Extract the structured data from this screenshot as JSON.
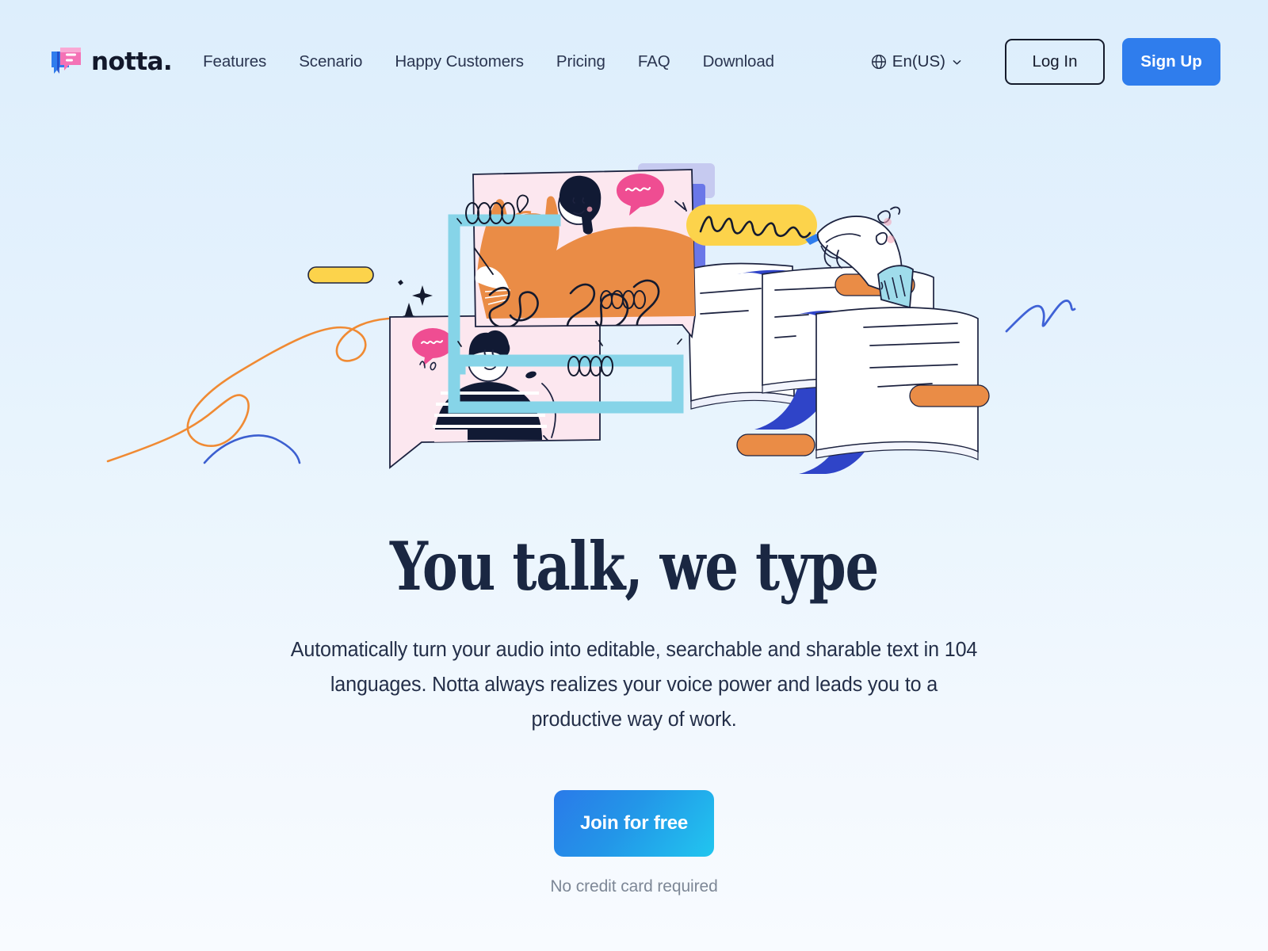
{
  "brand": {
    "name": "notta.",
    "logo_icon": "notta-speech-bubble-logo"
  },
  "nav": {
    "items": [
      {
        "label": "Features"
      },
      {
        "label": "Scenario"
      },
      {
        "label": "Happy Customers"
      },
      {
        "label": "Pricing"
      },
      {
        "label": "FAQ"
      },
      {
        "label": "Download"
      }
    ]
  },
  "header_right": {
    "language": {
      "icon": "globe-icon",
      "value": "En(US)",
      "chevron": "chevron-down-icon"
    },
    "login_label": "Log In",
    "signup_label": "Sign Up"
  },
  "hero": {
    "title": "You talk, we type",
    "subtitle": "Automatically turn your audio into editable, searchable and sharable text in 104 languages. Notta always realizes your voice power and leads you to a productive way of work.",
    "cta_label": "Join for free",
    "cta_note": "No credit card required",
    "illustration": {
      "name": "voice-to-text-hero-illustration",
      "elements": [
        "pink-speech-bubble-with-woman-and-orange-cat",
        "pink-speech-bubble-with-striped-shirt-person",
        "light-blue-connector-lines",
        "yellow-highlight-bar-with-handwriting",
        "hand-holding-pen",
        "flowing-document-pages-with-orange-highlights",
        "sparkle-marks",
        "orange-squiggle",
        "blue-squiggle",
        "small-yellow-pill"
      ]
    }
  },
  "colors": {
    "brand_blue": "#2f7ded",
    "cta_gradient_start": "#2a7ae9",
    "cta_gradient_end": "#21c6ef",
    "page_bg_top": "#ddeefc",
    "page_bg_bottom": "#f8fbff",
    "text_dark": "#1a2742",
    "muted_text": "#7d8796",
    "accent_pink": "#f4c9d8",
    "accent_orange": "#ea8c46",
    "accent_yellow": "#fcd34b",
    "accent_indigo": "#3341c4",
    "accent_periwinkle": "#6a77e8",
    "accent_lightblue": "#86d4e8"
  }
}
